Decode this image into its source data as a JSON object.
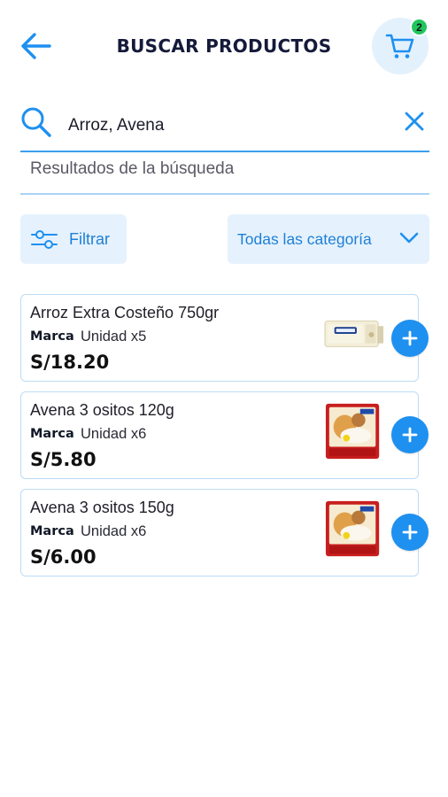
{
  "header": {
    "title": "BUSCAR PRODUCTOS",
    "cart_count": "2"
  },
  "search": {
    "value": "Arroz, Avena",
    "placeholder": ""
  },
  "results_label": "Resultados de la búsqueda",
  "filters": {
    "filter_label": "Filtrar",
    "category_label": "Todas las categoría"
  },
  "products": [
    {
      "name": "Arroz Extra Costeño 750gr",
      "brand": "Marca",
      "unit": "Unidad x5",
      "price": "S/18.20",
      "image": "rice-package"
    },
    {
      "name": "Avena 3 ositos 120g",
      "brand": "Marca",
      "unit": "Unidad x6",
      "price": "S/5.80",
      "image": "oats-bag"
    },
    {
      "name": "Avena 3 ositos 150g",
      "brand": "Marca",
      "unit": "Unidad x6",
      "price": "S/6.00",
      "image": "oats-bag"
    }
  ],
  "colors": {
    "accent": "#1e90f0",
    "light_accent": "#e5f2fd",
    "badge": "#22c55e",
    "title": "#151a3a"
  },
  "icons": {
    "back": "arrow-left-icon",
    "cart": "shopping-cart-icon",
    "search": "search-icon",
    "clear": "close-icon",
    "filter": "sliders-icon",
    "dropdown": "chevron-down-icon",
    "add": "plus-icon"
  }
}
